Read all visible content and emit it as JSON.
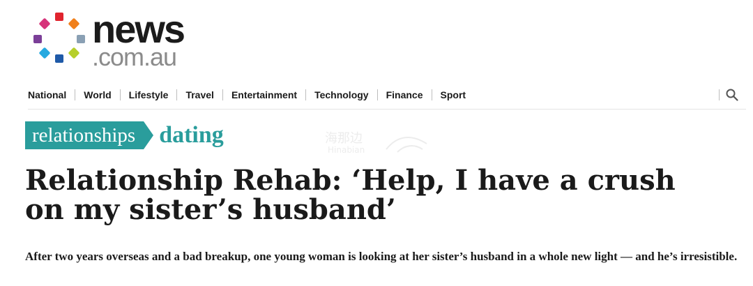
{
  "logo": {
    "wordmark": "news",
    "domain": ".com.au",
    "dot_colors": [
      "#d6337a",
      "#e0242e",
      "#f07f1b",
      "#7b3f98",
      "#8aa0b4",
      "#26a9e0",
      "#1f5aa8",
      "#b6cf2b"
    ]
  },
  "nav": {
    "items": [
      "National",
      "World",
      "Lifestyle",
      "Travel",
      "Entertainment",
      "Technology",
      "Finance",
      "Sport"
    ],
    "search_icon": "search-icon"
  },
  "breadcrumb": {
    "parent": "relationships",
    "current": "dating"
  },
  "watermark": {
    "text": "海那边",
    "sub": "Hinabian"
  },
  "article": {
    "headline": "Relationship Rehab: ‘Help, I have a crush on my sister’s husband’",
    "standfirst": "After two years overseas and a bad breakup, one young woman is looking at her sister’s husband in a whole new light — and he’s irresistible."
  },
  "colors": {
    "accent_teal": "#2a9d9c",
    "text": "#1a1a1a",
    "logo_grey": "#8b8b8b"
  }
}
